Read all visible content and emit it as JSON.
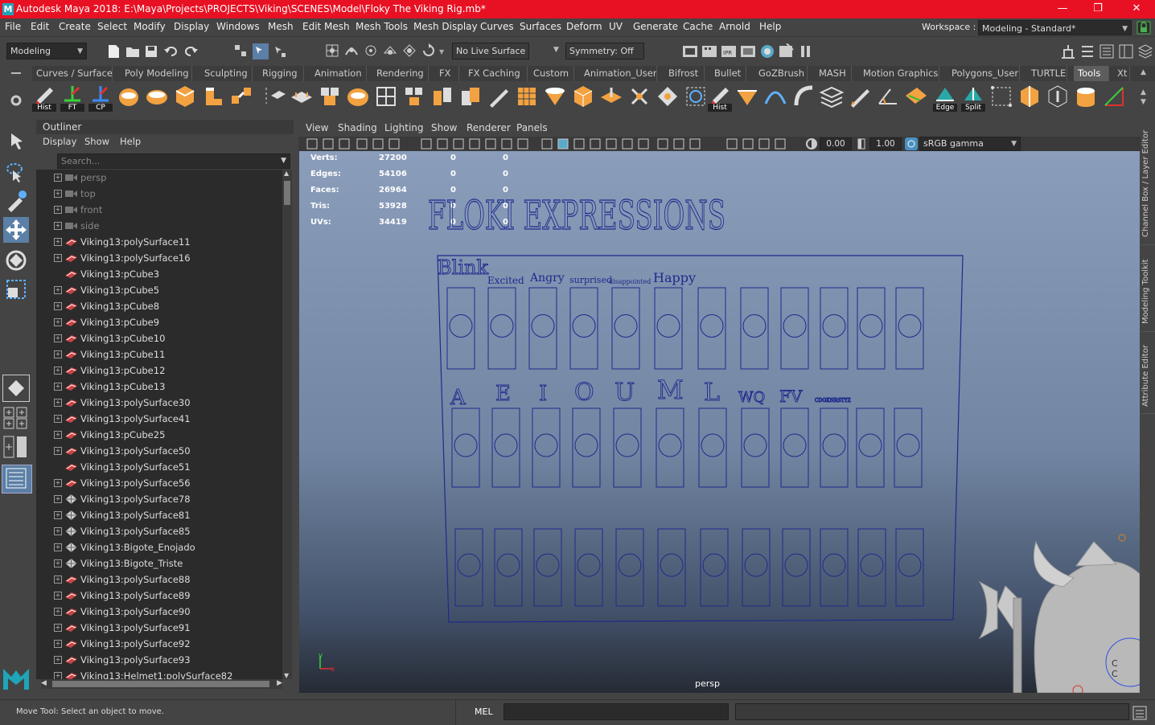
{
  "window": {
    "title": "Autodesk Maya 2018: E:\\Maya\\Projects\\PROJECTS\\Viking\\SCENES\\Model\\Floky The Viking Rig.mb*",
    "logo_letter": "M",
    "minimize": "—",
    "maximize": "❐",
    "close": "✕"
  },
  "menubar": {
    "items": [
      "File",
      "Edit",
      "Create",
      "Select",
      "Modify",
      "Display",
      "Windows",
      "Mesh",
      "Edit Mesh",
      "Mesh Tools",
      "Mesh Display",
      "Curves",
      "Surfaces",
      "Deform",
      "UV",
      "Generate",
      "Cache",
      "Arnold",
      "Help"
    ],
    "workspace_label": "Workspace :",
    "workspace_value": "Modeling - Standard*"
  },
  "statusline": {
    "menuset": "Modeling",
    "live_surface": "No Live Surface",
    "symmetry": "Symmetry: Off"
  },
  "shelf": {
    "tabs": [
      "Curves / Surfaces",
      "Poly Modeling",
      "Sculpting",
      "Rigging",
      "Animation",
      "Rendering",
      "FX",
      "FX Caching",
      "Custom",
      "Animation_User",
      "Bifrost",
      "Bullet",
      "GoZBrush",
      "MASH",
      "Motion Graphics",
      "Polygons_User",
      "TURTLE",
      "Tools",
      "Xt"
    ],
    "active_tab": "Tools",
    "icon_labels": {
      "hist": "Hist",
      "ft": "FT",
      "cp": "CP",
      "hist2": "Hist",
      "edge": "Edge",
      "split": "Split"
    }
  },
  "outliner": {
    "title": "Outliner",
    "menus": [
      "Display",
      "Show",
      "Help"
    ],
    "search_placeholder": "Search...",
    "items": [
      {
        "label": "persp",
        "type": "camera",
        "expand": true
      },
      {
        "label": "top",
        "type": "camera",
        "expand": true
      },
      {
        "label": "front",
        "type": "camera",
        "expand": true
      },
      {
        "label": "side",
        "type": "camera",
        "expand": true
      },
      {
        "label": "Viking13:polySurface11",
        "type": "mesh",
        "expand": true
      },
      {
        "label": "Viking13:polySurface16",
        "type": "mesh",
        "expand": true
      },
      {
        "label": "Viking13:pCube3",
        "type": "mesh",
        "expand": false
      },
      {
        "label": "Viking13:pCube5",
        "type": "mesh",
        "expand": true
      },
      {
        "label": "Viking13:pCube8",
        "type": "mesh",
        "expand": true
      },
      {
        "label": "Viking13:pCube9",
        "type": "mesh",
        "expand": true
      },
      {
        "label": "Viking13:pCube10",
        "type": "mesh",
        "expand": true
      },
      {
        "label": "Viking13:pCube11",
        "type": "mesh",
        "expand": true
      },
      {
        "label": "Viking13:pCube12",
        "type": "mesh",
        "expand": true
      },
      {
        "label": "Viking13:pCube13",
        "type": "mesh",
        "expand": true
      },
      {
        "label": "Viking13:polySurface30",
        "type": "mesh",
        "expand": true
      },
      {
        "label": "Viking13:polySurface41",
        "type": "mesh",
        "expand": true
      },
      {
        "label": "Viking13:pCube25",
        "type": "mesh",
        "expand": true
      },
      {
        "label": "Viking13:polySurface50",
        "type": "mesh",
        "expand": true
      },
      {
        "label": "Viking13:polySurface51",
        "type": "mesh",
        "expand": false
      },
      {
        "label": "Viking13:polySurface56",
        "type": "mesh",
        "expand": true
      },
      {
        "label": "Viking13:polySurface78",
        "type": "group",
        "expand": true
      },
      {
        "label": "Viking13:polySurface81",
        "type": "group",
        "expand": true
      },
      {
        "label": "Viking13:polySurface85",
        "type": "group",
        "expand": true
      },
      {
        "label": "Viking13:Bigote_Enojado",
        "type": "group",
        "expand": true
      },
      {
        "label": "Viking13:Bigote_Triste",
        "type": "group",
        "expand": true
      },
      {
        "label": "Viking13:polySurface88",
        "type": "mesh",
        "expand": true
      },
      {
        "label": "Viking13:polySurface89",
        "type": "mesh",
        "expand": true
      },
      {
        "label": "Viking13:polySurface90",
        "type": "mesh",
        "expand": true
      },
      {
        "label": "Viking13:polySurface91",
        "type": "mesh",
        "expand": true
      },
      {
        "label": "Viking13:polySurface92",
        "type": "mesh",
        "expand": true
      },
      {
        "label": "Viking13:polySurface93",
        "type": "mesh",
        "expand": true
      },
      {
        "label": "Viking13:Helmet1:polySurface82",
        "type": "mesh",
        "expand": true
      }
    ]
  },
  "viewport": {
    "menus": [
      "View",
      "Shading",
      "Lighting",
      "Show",
      "Renderer",
      "Panels"
    ],
    "exposure": "0.00",
    "gamma": "1.00",
    "color_space": "sRGB gamma",
    "camera_label": "persp",
    "axis_y": "y",
    "axis_x": "x",
    "hud": [
      {
        "label": "Verts:",
        "v1": "27200",
        "v2": "0",
        "v3": "0"
      },
      {
        "label": "Edges:",
        "v1": "54106",
        "v2": "0",
        "v3": "0"
      },
      {
        "label": "Faces:",
        "v1": "26964",
        "v2": "0",
        "v3": "0"
      },
      {
        "label": "Tris:",
        "v1": "53928",
        "v2": "0",
        "v3": "0"
      },
      {
        "label": "UVs:",
        "v1": "34419",
        "v2": "0",
        "v3": "0"
      }
    ],
    "board": {
      "title": "FLOKI EXPRESSIONS",
      "blink": "Blink",
      "row1_labels": [
        "Excited",
        "Angry",
        "surprised",
        "disappointed",
        "Happy"
      ],
      "row2_labels": [
        "A",
        "E",
        "I",
        "O",
        "U",
        "M",
        "L",
        "WQ",
        "FV",
        "CDGKNRSTYZ"
      ]
    }
  },
  "side_tabs": [
    "Channel Box / Layer Editor",
    "Modeling Toolkit",
    "Attribute Editor"
  ],
  "helpline": {
    "message": "Move Tool: Select an object to move.",
    "script_type": "MEL"
  }
}
